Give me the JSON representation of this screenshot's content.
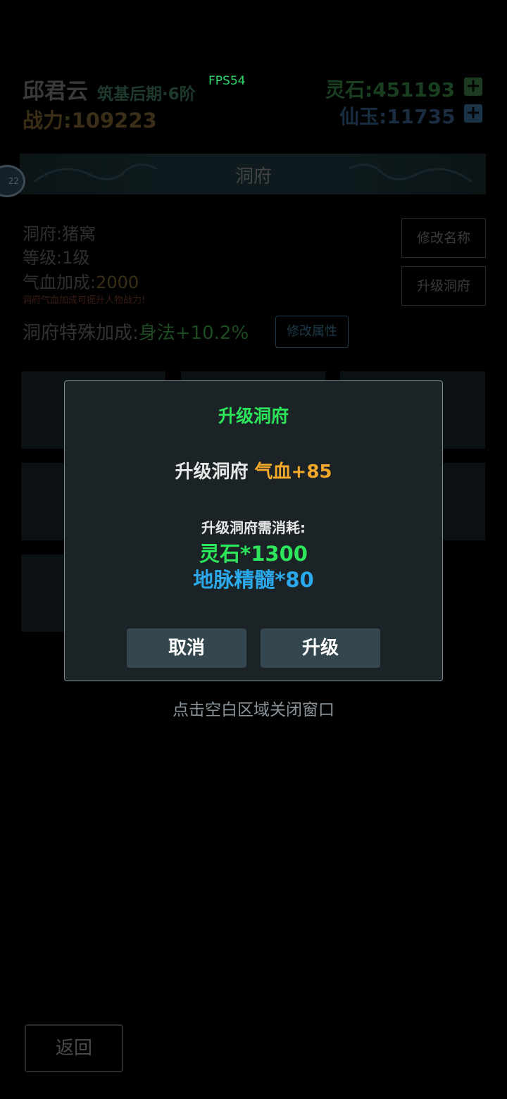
{
  "header": {
    "player_name": "邱君云",
    "realm": "筑基后期·6阶",
    "fps": "FPS54",
    "power_label": "战力:",
    "power_value": "109223",
    "stone_label": "灵石:",
    "stone_value": "451193",
    "jade_label": "仙玉:",
    "jade_value": "11735",
    "plus": "+"
  },
  "banner": {
    "title": "洞府",
    "badge": "22"
  },
  "cave": {
    "name_label": "洞府:",
    "name_value": "猪窝",
    "level_label": "等级:",
    "level_value": "1级",
    "hp_label": "气血加成:",
    "hp_value": "2000",
    "hint": "洞府气血加成可提升人物战力!",
    "special_label": "洞府特殊加成:",
    "special_value": "身法+10.2%",
    "edit_attr": "修改属性",
    "rename": "修改名称",
    "upgrade": "升级洞府"
  },
  "modal": {
    "title": "升级洞府",
    "effect_prefix": "升级洞府",
    "effect_value": "气血+85",
    "cost_label": "升级洞府需消耗:",
    "cost_1": "灵石*1300",
    "cost_2": "地脉精髓*80",
    "cancel": "取消",
    "confirm": "升级"
  },
  "close_hint": "点击空白区域关闭窗口",
  "footer": {
    "back": "返回"
  },
  "colors": {
    "modal_bg": "#1b2326",
    "title_green": "#2de55a",
    "gold": "#f3a92a",
    "blue": "#2aa8ea",
    "button_bg": "#34474e"
  }
}
